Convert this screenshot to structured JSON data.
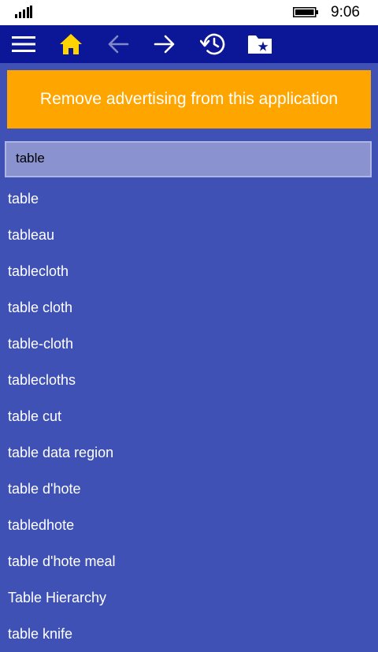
{
  "status_bar": {
    "time": "9:06",
    "icons": [
      "signal-strength-icon",
      "battery-icon"
    ]
  },
  "toolbar": {
    "icons": [
      "hamburger-menu-icon",
      "home-icon",
      "back-arrow-icon",
      "forward-arrow-icon",
      "history-icon",
      "favorites-folder-icon"
    ]
  },
  "colors": {
    "toolbar_bg": "#0c1797",
    "page_bg": "#3f51b5",
    "banner_bg": "#ffa500",
    "home_icon": "#ffd400",
    "search_bg": "#8a92cf"
  },
  "banner": {
    "text": "Remove advertising from this application"
  },
  "search": {
    "value": "table"
  },
  "suggestions": [
    "table",
    "tableau",
    "tablecloth",
    "table cloth",
    "table-cloth",
    "tablecloths",
    "table cut",
    "table data region",
    "table d'hote",
    "tabledhote",
    "table d'hote meal",
    "Table Hierarchy",
    "table knife"
  ]
}
